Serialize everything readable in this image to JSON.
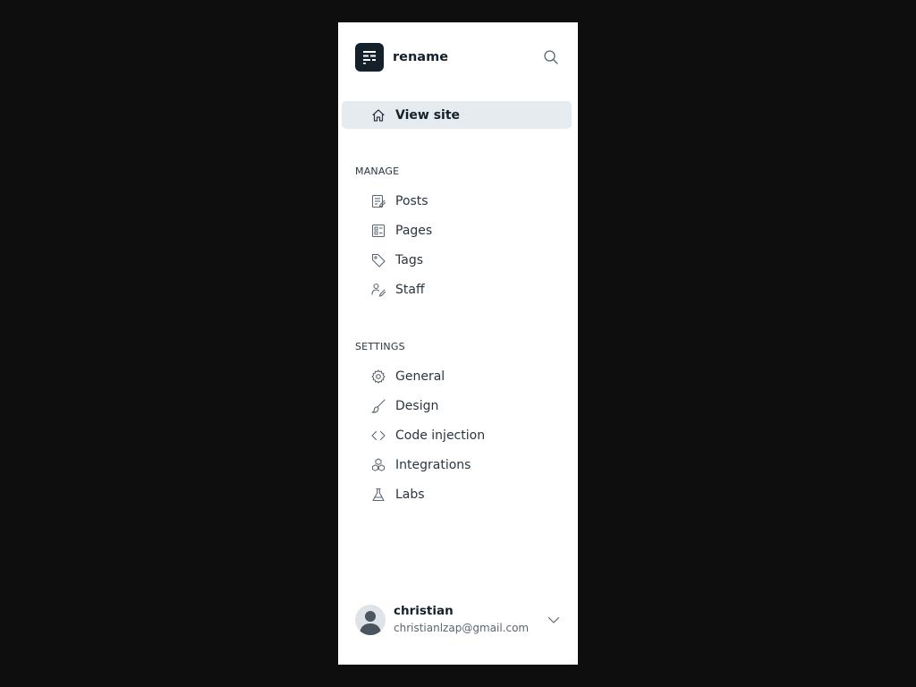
{
  "site": {
    "name": "rename"
  },
  "view_site": {
    "label": "View site"
  },
  "manage": {
    "title": "MANAGE",
    "items": [
      {
        "label": "Posts",
        "icon": "posts-icon"
      },
      {
        "label": "Pages",
        "icon": "pages-icon"
      },
      {
        "label": "Tags",
        "icon": "tag-icon"
      },
      {
        "label": "Staff",
        "icon": "staff-icon"
      }
    ]
  },
  "settings": {
    "title": "SETTINGS",
    "items": [
      {
        "label": "General",
        "icon": "gear-icon"
      },
      {
        "label": "Design",
        "icon": "brush-icon"
      },
      {
        "label": "Code injection",
        "icon": "code-icon"
      },
      {
        "label": "Integrations",
        "icon": "integrations-icon"
      },
      {
        "label": "Labs",
        "icon": "flask-icon"
      }
    ]
  },
  "user": {
    "name": "christian",
    "email": "christianlzap@gmail.com"
  },
  "colors": {
    "page_background": "#0e0e0e",
    "sidebar_background": "#ffffff",
    "active_background": "#e6ebf0",
    "logo_background": "#15212a",
    "text_primary": "#15212a",
    "text_secondary": "#5c6670"
  }
}
